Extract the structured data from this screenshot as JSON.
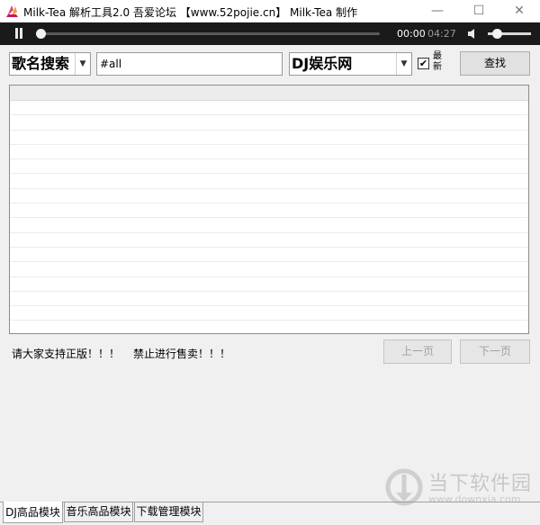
{
  "window": {
    "title": "Milk-Tea 解析工具2.0    吾爱论坛 【www.52pojie.cn】 Milk-Tea 制作",
    "minimize_glyph": "—",
    "maximize_glyph": "☐",
    "close_glyph": "✕"
  },
  "player": {
    "current_time": "00:00",
    "total_time": "04:27",
    "progress": 0.0,
    "volume_level": 0.15
  },
  "search": {
    "mode_selected": "歌名搜索",
    "query_value": "#all",
    "source_selected": "DJ娱乐网",
    "latest_checked": true,
    "latest_label": "最新",
    "search_button": "查找"
  },
  "results": {
    "rows": []
  },
  "notices": {
    "left": "请大家支持正版！！！",
    "right": "禁止进行售卖！！！"
  },
  "pagination": {
    "prev_label": "上一页",
    "next_label": "下一页"
  },
  "tabs": [
    {
      "label": "DJ高品模块",
      "active": true
    },
    {
      "label": "音乐高品模块",
      "active": false
    },
    {
      "label": "下载管理模块",
      "active": false
    }
  ],
  "watermark": {
    "name": "当下软件园",
    "url": "www.downxia.com"
  },
  "colors": {
    "player_bg": "#1a1a1a",
    "window_bg": "#f0f0f0",
    "icon_pink": "#e8437a",
    "icon_orange": "#f59a2a"
  }
}
